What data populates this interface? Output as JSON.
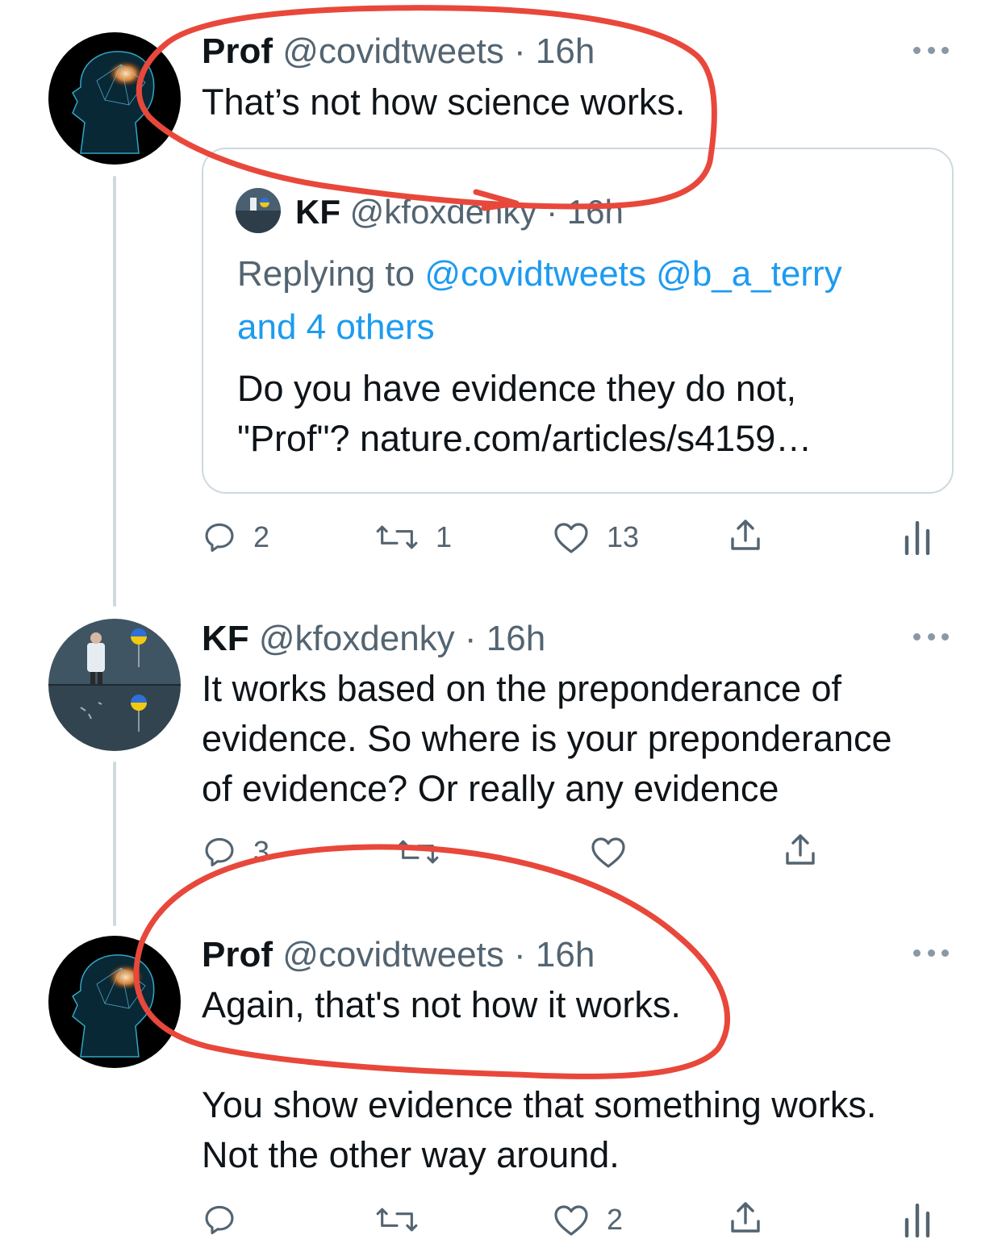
{
  "tweets": [
    {
      "name": "Prof",
      "handle": "@covidtweets",
      "dot": "·",
      "time": "16h",
      "lines": [
        "That’s not how science works."
      ],
      "quote": {
        "name": "KF",
        "handle": "@kfoxdenky",
        "dot": "·",
        "time": "16h",
        "replying_prefix": "Replying to ",
        "replying_links": [
          "@covidtweets",
          "@b_a_terry",
          "and 4 others"
        ],
        "lines": [
          "Do you have evidence they do not,",
          "\"Prof\"? nature.com/articles/s4159…"
        ]
      },
      "actions": {
        "reply_count": "2",
        "retweet_count": "1",
        "like_count": "13"
      }
    },
    {
      "name": "KF",
      "handle": "@kfoxdenky",
      "dot": "·",
      "time": "16h",
      "lines": [
        "It works based on the preponderance of",
        "evidence.  So where is your preponderance",
        "of evidence?  Or really any evidence"
      ],
      "actions": {
        "reply_count": "3",
        "retweet_count": "",
        "like_count": ""
      }
    },
    {
      "name": "Prof",
      "handle": "@covidtweets",
      "dot": "·",
      "time": "16h",
      "lines": [
        "Again, that's not how it works.",
        "",
        "You show evidence that something works.",
        "Not the other way around."
      ],
      "actions": {
        "reply_count": "",
        "retweet_count": "",
        "like_count": "2"
      }
    }
  ],
  "icons": {
    "reply": "reply-icon",
    "retweet": "retweet-icon",
    "like": "heart-icon",
    "share": "share-icon",
    "analytics": "analytics-icon",
    "more": "more-icon"
  },
  "colors": {
    "text": "#0f1419",
    "secondary": "#536471",
    "link": "#1d9bf0",
    "border": "#cfd9de",
    "annotation": "#e8483b"
  }
}
